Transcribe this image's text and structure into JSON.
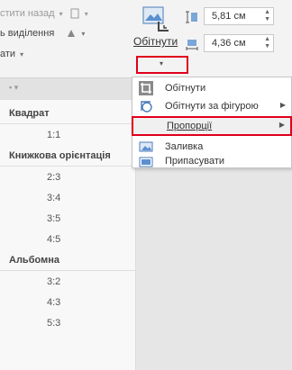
{
  "ribbon": {
    "row1_text": "стити назад",
    "row2_text": "ь виділення",
    "row3_text": "ати",
    "crop_label": "Обітнути",
    "height_value": "5,81 см",
    "width_value": "4,36 см"
  },
  "pane": {
    "header_text": "▪ ▾",
    "groups": [
      {
        "title": "Квадрат",
        "items": [
          "1:1"
        ]
      },
      {
        "title": "Книжкова орієнтація",
        "items": [
          "2:3",
          "3:4",
          "3:5",
          "4:5"
        ]
      },
      {
        "title": "Альбомна",
        "items": [
          "3:2",
          "4:3",
          "5:3"
        ]
      }
    ]
  },
  "menu": {
    "items": [
      {
        "label": "Обітнути",
        "icon": "crop-icon"
      },
      {
        "label": "Обітнути за фігурою",
        "icon": "crop-shape-icon",
        "submenu": true
      },
      {
        "label": "Пропорції",
        "icon": "aspect-ratio-icon",
        "submenu": true
      },
      {
        "label": "Заливка",
        "icon": "fill-icon"
      },
      {
        "label": "Припасувати",
        "icon": "fit-icon"
      }
    ]
  },
  "colors": {
    "highlight": "#e0001b",
    "ribbon_bg": "#f3f3f3",
    "canvas_bg": "#e6e6e6"
  }
}
